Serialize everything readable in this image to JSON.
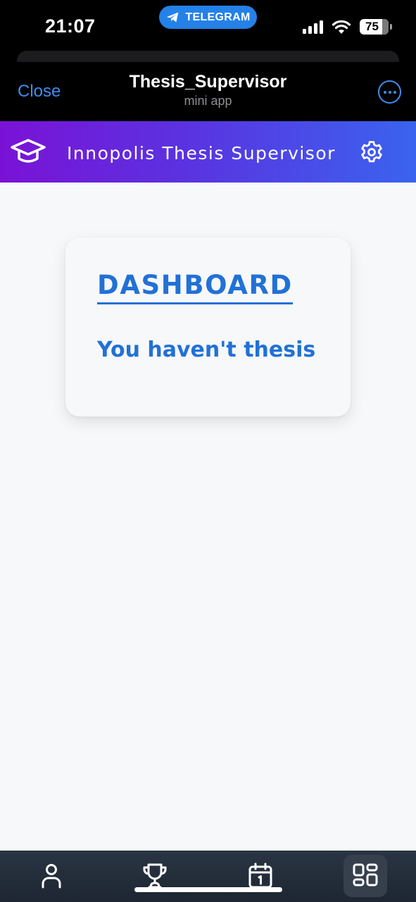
{
  "status_bar": {
    "time": "21:07",
    "telegram_pill": "TELEGRAM",
    "battery": "75"
  },
  "header": {
    "close_label": "Close",
    "title": "Thesis_Supervisor",
    "subtitle": "mini app"
  },
  "app_bar": {
    "title": "Innopolis Thesis Supervisor"
  },
  "dashboard": {
    "title": "DASHBOARD",
    "message": "You haven't thesis"
  },
  "bottom_nav": {
    "items": [
      {
        "icon": "user-icon",
        "active": false
      },
      {
        "icon": "trophy-icon",
        "active": false
      },
      {
        "icon": "calendar-icon",
        "active": false
      },
      {
        "icon": "grid-icon",
        "active": true
      }
    ]
  },
  "colors": {
    "accent": "#2171d6",
    "telegram_blue": "#3d8ef0",
    "gradient_start": "#7a12d6",
    "gradient_end": "#3a63ef",
    "nav_bg": "#1d2632"
  }
}
